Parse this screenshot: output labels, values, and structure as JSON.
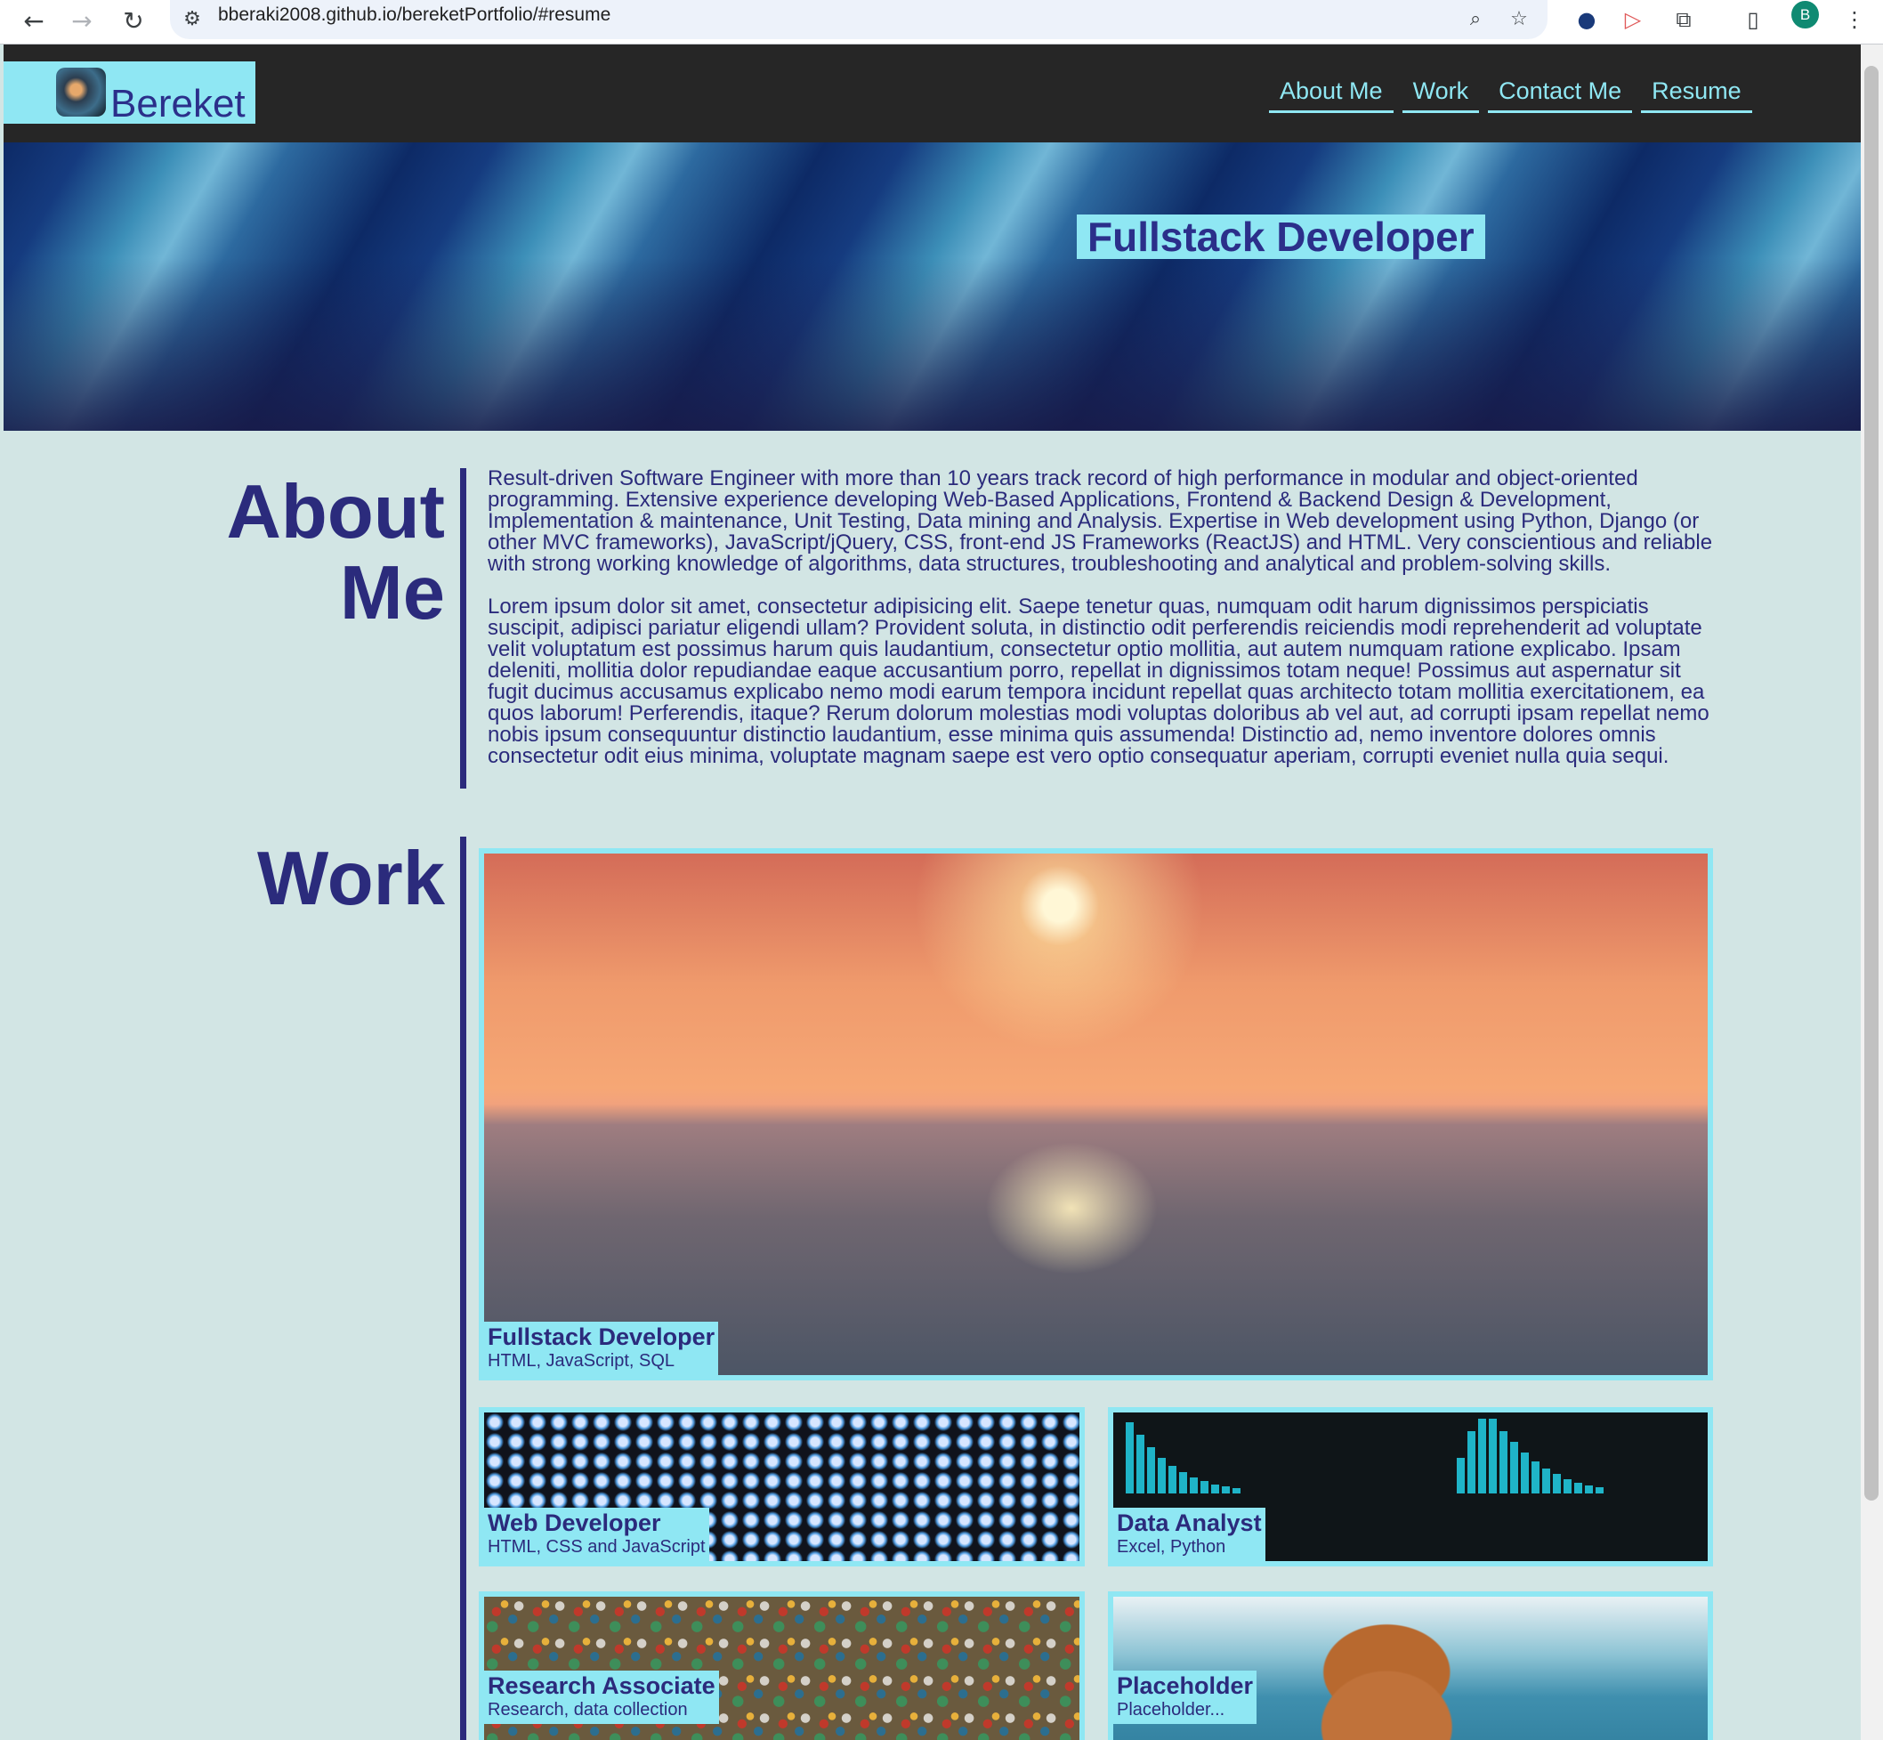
{
  "browser": {
    "url": "bberaki2008.github.io/bereketPortfolio/#resume",
    "profile_initial": "B"
  },
  "header": {
    "brand_name": "Bereket",
    "nav": [
      "About Me",
      "Work",
      "Contact Me",
      "Resume"
    ]
  },
  "hero": {
    "title": "Fullstack Developer"
  },
  "about": {
    "heading_line1": "About",
    "heading_line2": "Me",
    "paragraphs": [
      "Result-driven Software Engineer with more than 10 years track record of high performance in modular and object-oriented programming. Extensive experience developing Web-Based Applications, Frontend & Backend Design & Development, Implementation & maintenance, Unit Testing, Data mining and Analysis. Expertise in Web development using Python, Django (or other MVC frameworks), JavaScript/jQuery, CSS, front-end JS Frameworks (ReactJS) and HTML. Very conscientious and reliable with strong working knowledge of algorithms, data structures, troubleshooting and analytical and problem-solving skills.",
      "Lorem ipsum dolor sit amet, consectetur adipisicing elit. Saepe tenetur quas, numquam odit harum dignissimos perspiciatis suscipit, adipisci pariatur eligendi ullam? Provident soluta, in distinctio odit perferendis reiciendis modi reprehenderit ad voluptate velit voluptatum est possimus harum quis laudantium, consectetur optio mollitia, aut autem numquam ratione explicabo. Ipsam deleniti, mollitia dolor repudiandae eaque accusantium porro, repellat in dignissimos totam neque! Possimus aut aspernatur sit fugit ducimus accusamus explicabo nemo modi earum tempora incidunt repellat quas architecto totam mollitia exercitationem, ea quos laborum! Perferendis, itaque? Rerum dolorum molestias modi voluptas doloribus ab vel aut, ad corrupti ipsam repellat nemo nobis ipsum consequuntur distinctio laudantium, esse minima quis assumenda! Distinctio ad, nemo inventore dolores omnis consectetur odit eius minima, voluptate magnam saepe est vero optio consequatur aperiam, corrupti eveniet nulla quia sequi."
    ]
  },
  "work": {
    "heading": "Work",
    "projects": [
      {
        "title": "Fullstack Developer",
        "subtitle": "HTML, JavaScript, SQL"
      },
      {
        "title": "Web Developer",
        "subtitle": "HTML, CSS and JavaScript"
      },
      {
        "title": "Data Analyst",
        "subtitle": "Excel, Python"
      },
      {
        "title": "Research Associate",
        "subtitle": "Research, data collection"
      },
      {
        "title": "Placeholder",
        "subtitle": "Placeholder..."
      }
    ]
  },
  "colors": {
    "accent": "#8fe7f3",
    "navy": "#2b2b7c",
    "page_bg": "#d2e5e4",
    "header_bg": "#262626"
  }
}
